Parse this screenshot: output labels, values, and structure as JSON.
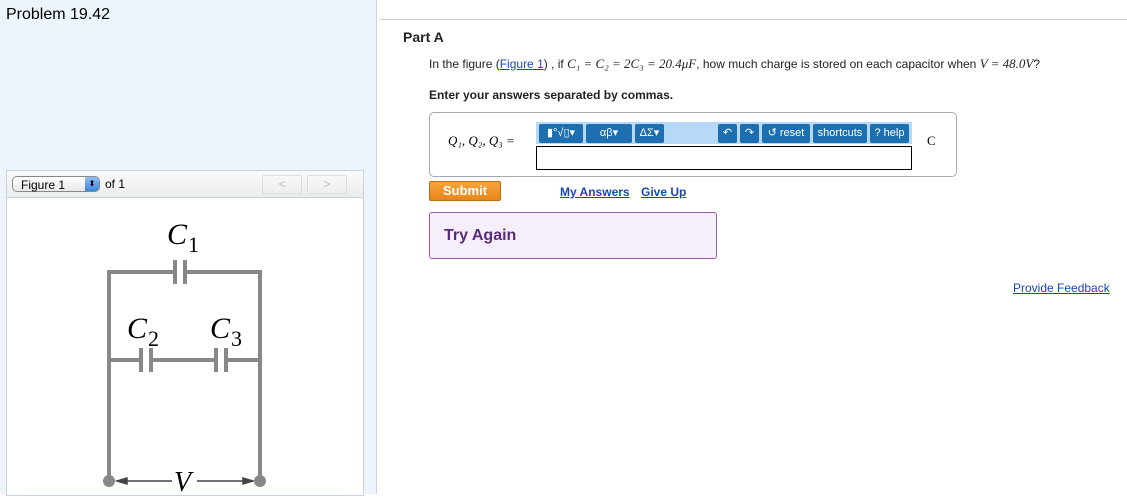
{
  "problem_title": "Problem 19.42",
  "figure": {
    "selected": "Figure 1",
    "of_label": "of 1",
    "prev": "<",
    "next": ">",
    "labels": {
      "c1": "C",
      "c1_sub": "1",
      "c2": "C",
      "c2_sub": "2",
      "c3": "C",
      "c3_sub": "3",
      "v": "V"
    }
  },
  "part": {
    "title": "Part A",
    "question_prefix": "In the figure (",
    "figure_link": "Figure 1",
    "question_mid": ") , if ",
    "math_condition": "C₁ = C₂ = 2C₃ = 20.4μF",
    "question_mid2": ", how much charge is stored on each capacitor when ",
    "math_voltage": "V = 48.0V",
    "question_suffix": "?",
    "instruction": "Enter your answers separated by commas.",
    "answer_label": "Q₁, Q₂, Q₃ =",
    "answer_value": "",
    "unit": "C",
    "toolbar": {
      "templates": "▮°√▯▾",
      "greek": "αβ▾",
      "symbols": "ΔΣ▾",
      "undo": "↶",
      "redo": "↷",
      "reset": "↺ reset",
      "shortcuts": "shortcuts",
      "help": "? help"
    },
    "submit": "Submit",
    "my_answers": "My Answers",
    "give_up": "Give Up",
    "feedback_msg": "Try Again"
  },
  "provide_feedback": "Provide Feedback"
}
